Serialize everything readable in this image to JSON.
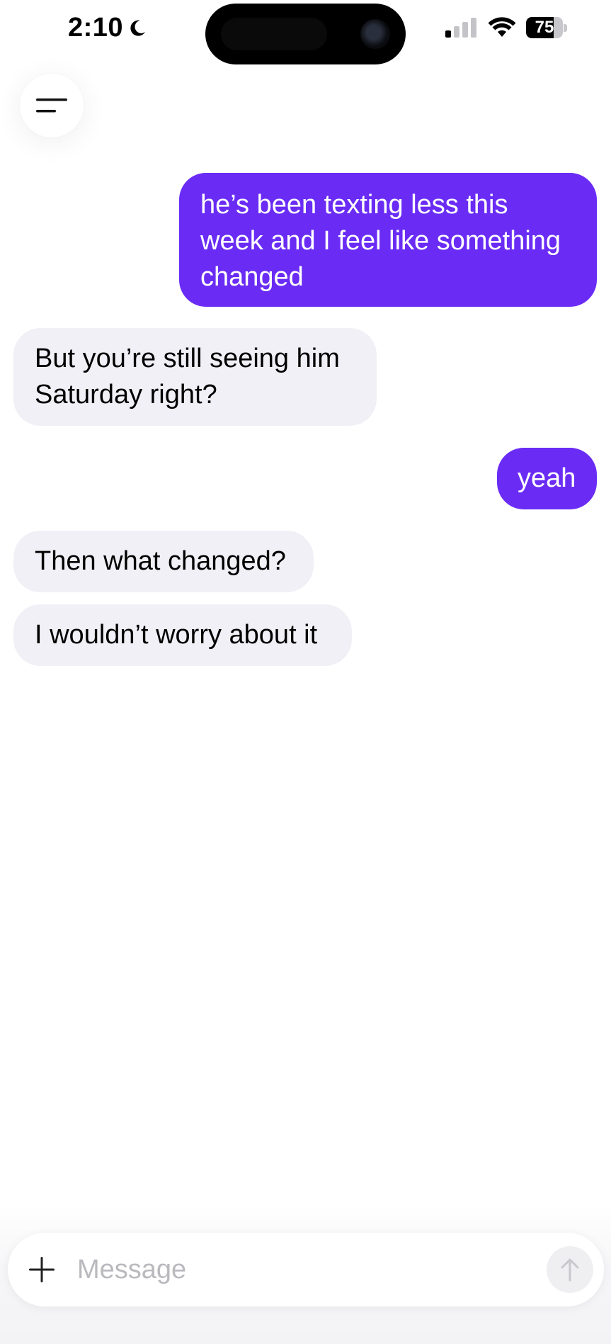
{
  "status_bar": {
    "time": "2:10",
    "battery_percent": "75",
    "battery_level": 0.75,
    "icons": [
      "moon-icon",
      "cellular-signal-icon",
      "wifi-icon",
      "battery-icon"
    ]
  },
  "header": {
    "menu_icon": "menu-icon"
  },
  "messages": [
    {
      "sender": "user",
      "text": "he’s been texting less this week and I feel like something changed"
    },
    {
      "sender": "assistant",
      "text": "But you’re still seeing him Saturday right?"
    },
    {
      "sender": "user",
      "text": "yeah"
    },
    {
      "sender": "assistant",
      "text": "Then what changed?"
    },
    {
      "sender": "assistant",
      "text": "I wouldn’t worry about it"
    }
  ],
  "composer": {
    "placeholder": "Message",
    "value": "",
    "plus_icon": "plus-icon",
    "send_icon": "arrow-up-icon"
  },
  "colors": {
    "outgoing_bubble": "#6a2cf5",
    "incoming_bubble": "#f1f0f6",
    "placeholder_text": "#b9b9be"
  }
}
